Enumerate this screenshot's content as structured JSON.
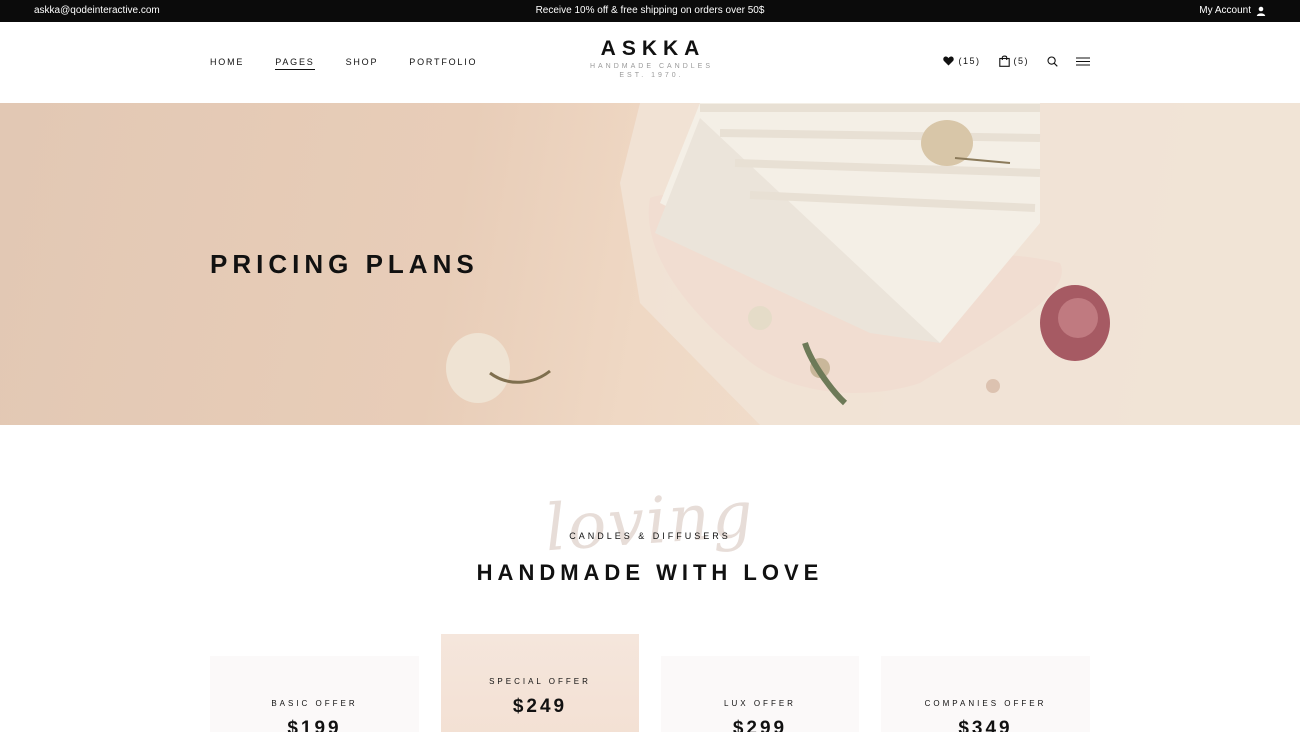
{
  "topbar": {
    "email": "askka@qodeinteractive.com",
    "promo": "Receive 10% off & free shipping on orders over 50$",
    "account_label": "My Account",
    "account_icon": "user-icon"
  },
  "nav": {
    "items": [
      {
        "label": "HOME"
      },
      {
        "label": "PAGES",
        "active": true
      },
      {
        "label": "SHOP"
      },
      {
        "label": "PORTFOLIO"
      }
    ]
  },
  "logo": {
    "brand": "ASKKA",
    "tagline": "HANDMADE CANDLES",
    "est": "EST. 1970."
  },
  "tools": {
    "wishlist_count": "(15)",
    "cart_count": "(5)",
    "icons": [
      "heart-icon",
      "shopping-bag-icon",
      "search-icon",
      "menu-icon"
    ]
  },
  "hero": {
    "title": "PRICING PLANS"
  },
  "section": {
    "script": "loving",
    "subtitle": "CANDLES & DIFFUSERS",
    "heading": "HANDMADE WITH LOVE"
  },
  "cards": [
    {
      "label": "BASIC OFFER",
      "price": "$199"
    },
    {
      "label": "SPECIAL OFFER",
      "price": "$249"
    },
    {
      "label": "LUX OFFER",
      "price": "$299"
    },
    {
      "label": "COMPANIES OFFER",
      "price": "$349"
    }
  ],
  "colors": {
    "topbar_bg": "#0b0b0b",
    "hero_bg": "#e8cdb8",
    "card_bg": "#fbf9f9",
    "special_card_bg": "#f4e3d7"
  }
}
